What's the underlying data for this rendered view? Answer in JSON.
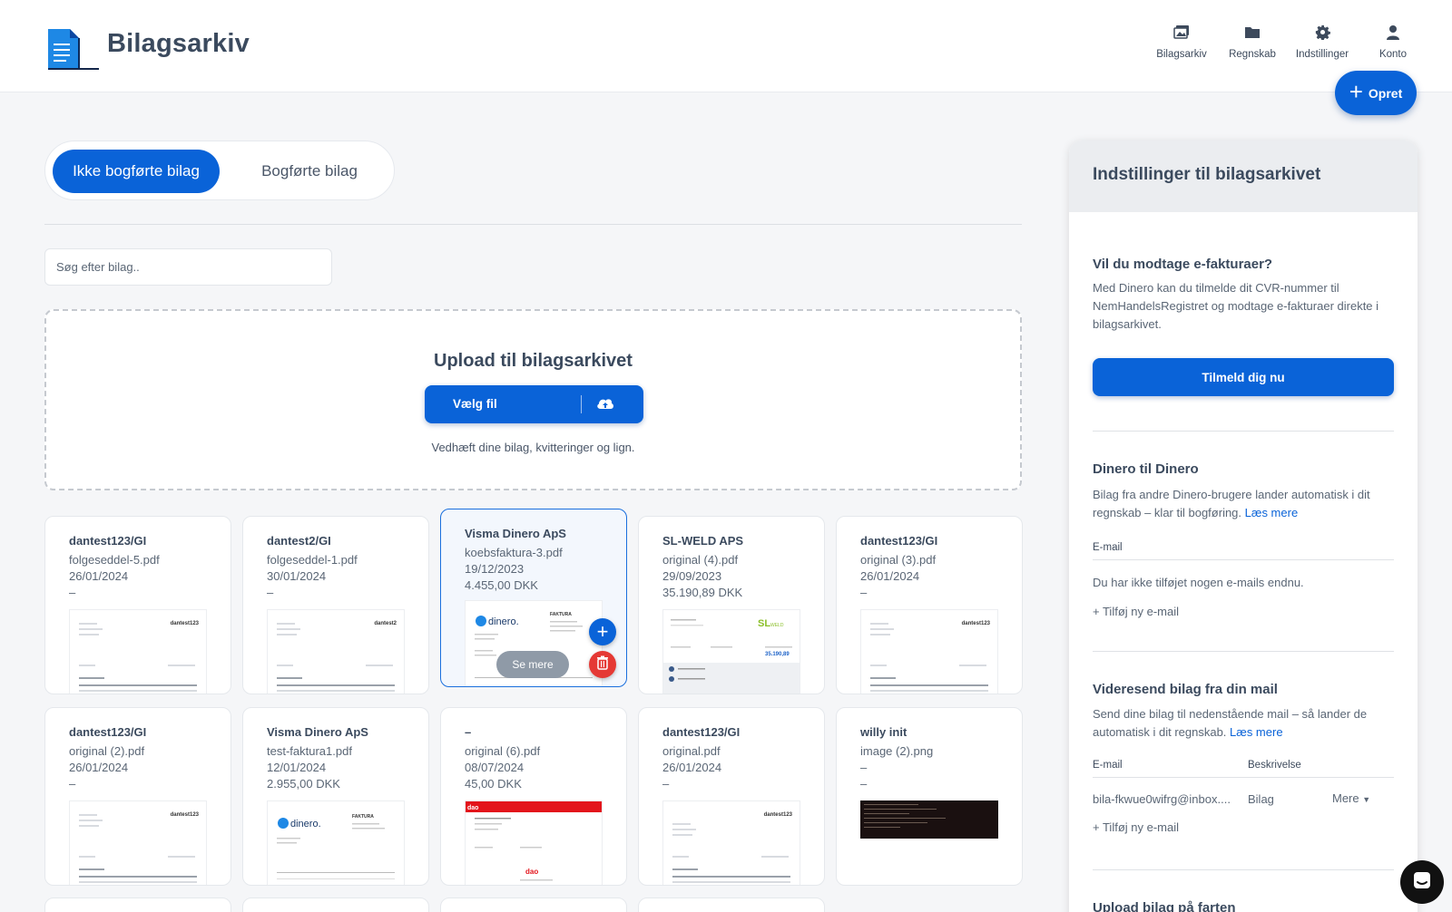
{
  "app": {
    "title": "Bilagsarkiv"
  },
  "nav": [
    {
      "label": "Bilagsarkiv",
      "icon": "images-icon"
    },
    {
      "label": "Regnskab",
      "icon": "folder-icon"
    },
    {
      "label": "Indstillinger",
      "icon": "gear-icon"
    },
    {
      "label": "Konto",
      "icon": "user-icon"
    }
  ],
  "create_button": {
    "label": "Opret"
  },
  "tabs": {
    "active": "Ikke bogførte bilag",
    "inactive": "Bogførte bilag"
  },
  "search": {
    "placeholder": "Søg efter bilag.."
  },
  "upload": {
    "title": "Upload til bilagsarkivet",
    "button": "Vælg fil",
    "hint": "Vedhæft dine bilag, kvitteringer og lign."
  },
  "cards": [
    {
      "sender": "dantest123/GI",
      "file": "folgeseddel-5.pdf",
      "date": "26/01/2024",
      "amount": "–"
    },
    {
      "sender": "dantest2/GI",
      "file": "folgeseddel-1.pdf",
      "date": "30/01/2024",
      "amount": "–"
    },
    {
      "sender": "Visma Dinero ApS",
      "file": "koebsfaktura-3.pdf",
      "date": "19/12/2023",
      "amount": "4.455,00 DKK"
    },
    {
      "sender": "SL-WELD APS",
      "file": "original (4).pdf",
      "date": "29/09/2023",
      "amount": "35.190,89 DKK"
    },
    {
      "sender": "dantest123/GI",
      "file": "original (3).pdf",
      "date": "26/01/2024",
      "amount": "–"
    },
    {
      "sender": "dantest123/GI",
      "file": "original (2).pdf",
      "date": "26/01/2024",
      "amount": "–"
    },
    {
      "sender": "Visma Dinero ApS",
      "file": "test-faktura1.pdf",
      "date": "12/01/2024",
      "amount": "2.955,00 DKK"
    },
    {
      "sender": "–",
      "file": "original (6).pdf",
      "date": "08/07/2024",
      "amount": "45,00 DKK"
    },
    {
      "sender": "dantest123/GI",
      "file": "original.pdf",
      "date": "26/01/2024",
      "amount": "–"
    },
    {
      "sender": "willy init",
      "file": "image (2).png",
      "date": "–",
      "amount": "–"
    }
  ],
  "card_actions": {
    "see_more": "Se mere",
    "add": "+"
  },
  "panel": {
    "title": "Indstillinger til bilagsarkivet",
    "einvoice": {
      "heading": "Vil du modtage e-fakturaer?",
      "text": "Med Dinero kan du tilmelde dit CVR-nummer til NemHandelsRegistret og modtage e-fakturaer direkte i bilagsarkivet.",
      "button": "Tilmeld dig nu"
    },
    "d2d": {
      "heading": "Dinero til Dinero",
      "text": "Bilag fra andre Dinero-brugere lander automatisk i dit regnskab – klar til bogføring.",
      "link": "Læs mere",
      "email_label": "E-mail",
      "empty": "Du har ikke tilføjet nogen e-mails endnu.",
      "add_link": "+ Tilføj ny e-mail"
    },
    "forward": {
      "heading": "Videresend bilag fra din mail",
      "text": "Send dine bilag til nedenstående mail – så lander de automatisk i dit regnskab.",
      "link": "Læs mere",
      "col_email": "E-mail",
      "col_desc": "Beskrivelse",
      "row_email": "bila-fkwue0wifrg@inbox....",
      "row_desc": "Bilag",
      "row_more": "Mere",
      "add_link": "+ Tilføj ny e-mail"
    },
    "upload_go": {
      "heading": "Upload bilag på farten"
    }
  },
  "colors": {
    "primary": "#0a63d8",
    "danger": "#e53935",
    "text": "#3b4a5e"
  }
}
